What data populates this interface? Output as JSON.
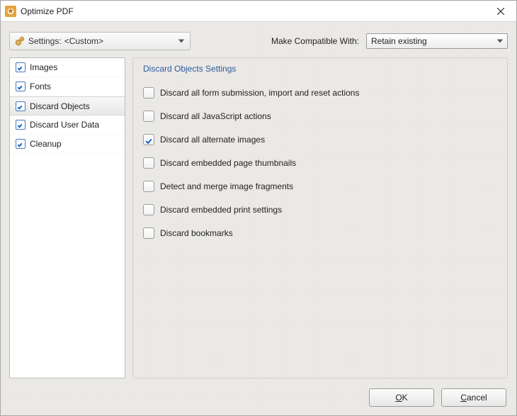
{
  "window": {
    "title": "Optimize PDF"
  },
  "toolbar": {
    "settings_label": "Settings:",
    "settings_value": "<Custom>",
    "compat_label": "Make Compatible With:",
    "compat_value": "Retain existing"
  },
  "sidebar": {
    "items": [
      {
        "label": "Images",
        "checked": true,
        "selected": false
      },
      {
        "label": "Fonts",
        "checked": true,
        "selected": false
      },
      {
        "label": "Discard Objects",
        "checked": true,
        "selected": true
      },
      {
        "label": "Discard User Data",
        "checked": true,
        "selected": false
      },
      {
        "label": "Cleanup",
        "checked": true,
        "selected": false
      }
    ]
  },
  "panel": {
    "title": "Discard Objects Settings",
    "options": [
      {
        "label": "Discard all form submission, import and reset actions",
        "checked": false
      },
      {
        "label": "Discard all JavaScript actions",
        "checked": false
      },
      {
        "label": "Discard all alternate images",
        "checked": true
      },
      {
        "label": "Discard embedded page thumbnails",
        "checked": false
      },
      {
        "label": "Detect and merge image fragments",
        "checked": false
      },
      {
        "label": "Discard embedded print settings",
        "checked": false
      },
      {
        "label": "Discard bookmarks",
        "checked": false
      }
    ]
  },
  "buttons": {
    "ok": "OK",
    "cancel": "Cancel"
  }
}
